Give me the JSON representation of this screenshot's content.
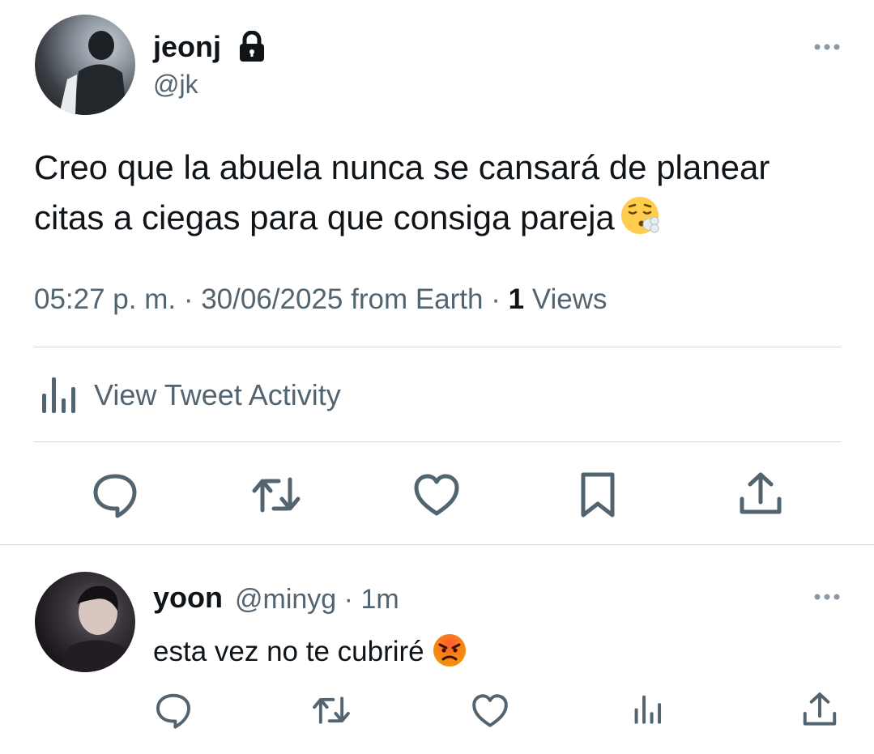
{
  "tweet": {
    "author_name": "jeonj",
    "author_handle": "@jk",
    "text": "Creo que la abuela nunca se cansará de planear citas a ciegas para que consiga pareja",
    "emoji": "face-exhaling-emoji",
    "time": "05:27 p. m.",
    "separator": " · ",
    "date": "30/06/2025",
    "source": " from Earth",
    "views_count": "1",
    "views_label": " Views",
    "activity_label": "View Tweet Activity"
  },
  "reply": {
    "author_name": "yoon",
    "author_handle": "@minyg",
    "separator": " · ",
    "age": "1m",
    "text": "esta vez no te cubriré",
    "emoji": "angry-face-emoji"
  },
  "icons": {
    "reply": "reply-icon",
    "retweet": "retweet-icon",
    "like": "like-icon",
    "bookmark": "bookmark-icon",
    "share": "share-icon",
    "analytics": "analytics-icon",
    "lock": "lock-icon",
    "more": "more-icon"
  },
  "colors": {
    "text_primary": "#0f1419",
    "text_secondary": "#536471",
    "divider": "#cfd9de"
  }
}
